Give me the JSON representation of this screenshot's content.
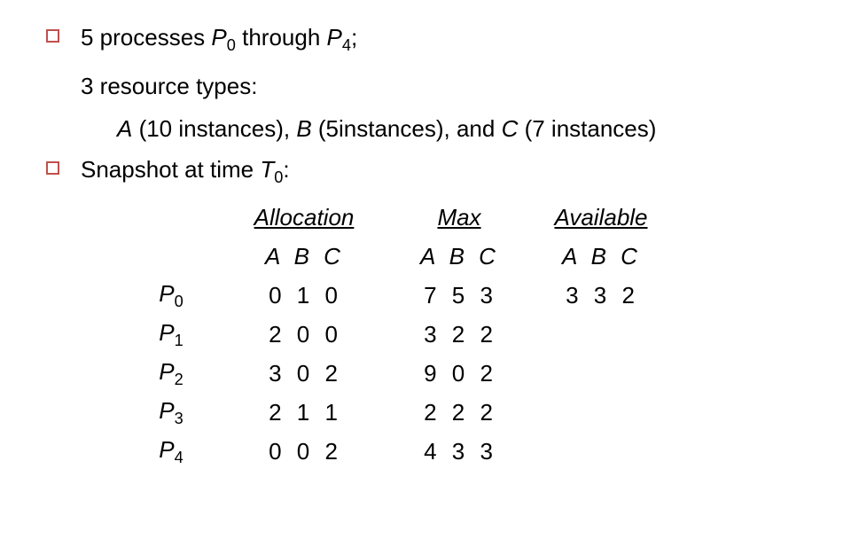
{
  "line1": {
    "prefix": "5 processes ",
    "p0": "P",
    "p0_sub": "0",
    "mid": " through ",
    "p4": "P",
    "p4_sub": "4",
    "suffix": ";"
  },
  "line2": "3 resource types:",
  "line3": {
    "a_name": "A",
    "a_inst": " (10 instances), ",
    "b_name": "  B",
    "b_inst": " (5instances), ",
    "and": "and ",
    "c_name": "C",
    "c_inst": " (7 instances)"
  },
  "line4": {
    "prefix": "Snapshot at time ",
    "t": "T",
    "t_sub": "0",
    "suffix": ":"
  },
  "headers": {
    "allocation": "Allocation",
    "max": "Max",
    "available": "Available"
  },
  "abc": "A B C",
  "processes": [
    {
      "name": "P",
      "sub": "0",
      "alloc": "0 1 0",
      "max": "7 5 3",
      "avail": "3 3 2"
    },
    {
      "name": "P",
      "sub": "1",
      "alloc": "2 0 0",
      "max": "3 2 2",
      "avail": ""
    },
    {
      "name": "P",
      "sub": "2",
      "alloc": "3 0 2",
      "max": "9 0 2",
      "avail": ""
    },
    {
      "name": "P",
      "sub": "3",
      "alloc": "2 1 1",
      "max": "2 2 2",
      "avail": ""
    },
    {
      "name": "P",
      "sub": "4",
      "alloc": "0 0 2",
      "max": "4 3 3",
      "avail": ""
    }
  ]
}
